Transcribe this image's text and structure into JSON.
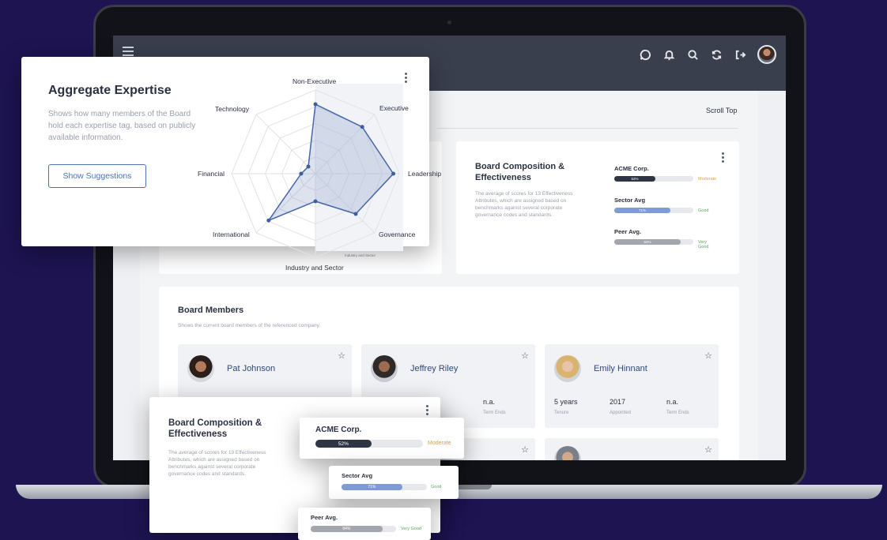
{
  "nav": {
    "icons": [
      "chat-icon",
      "bell-icon",
      "search-icon",
      "refresh-icon",
      "logout-icon"
    ]
  },
  "page": {
    "scroll_top": "Scroll Top"
  },
  "composition": {
    "title": "Board Composition & Effectiveness",
    "title_line1": "Board Composition &",
    "title_line2": "Effectiveness",
    "desc_line1": "The average of scores for 13 Effectiveness",
    "desc_line2": "Attributes, which are assigned based on",
    "desc_line3": "benchmarks against several corporate",
    "desc_line4": "governance codes and standards.",
    "rows": [
      {
        "label": "ACME Corp.",
        "percent": 52,
        "percent_text": "52%",
        "status": "Moderate",
        "status_color": "#d8a43a",
        "bar_color": "#2f3545"
      },
      {
        "label": "Sector Avg",
        "percent": 71,
        "percent_text": "71%",
        "status": "Good",
        "status_color": "#5aa55e",
        "bar_color": "#7e9bd4"
      },
      {
        "label": "Peer Avg.",
        "percent": 84,
        "percent_text": "84%",
        "status": "Very Good",
        "status_color": "#5aa55e",
        "bar_color": "#a3a6ad"
      }
    ]
  },
  "board": {
    "title": "Board Members",
    "desc": "Shows the current board members of the referenced company.",
    "members": [
      {
        "name": "Pat Johnson"
      },
      {
        "name": "Jeffrey Riley",
        "stat2_value": "n.a.",
        "stat2_label": "Term Ends"
      },
      {
        "name": "Emily Hinnant",
        "tenure_value": "5 years",
        "tenure_label": "Tenure",
        "appointed_value": "2017",
        "appointed_label": "Appointed",
        "term_value": "n.a.",
        "term_label": "Term Ends"
      }
    ]
  },
  "aggregate": {
    "title": "Aggregate Expertise",
    "desc": "Shows how many members of the Board hold each expertise tag, based on publicly available information.",
    "button": "Show Suggestions",
    "axes": [
      "Non-Executive",
      "Executive",
      "Leadership",
      "Governance",
      "Industry and Sector",
      "International",
      "Financial",
      "Technology"
    ],
    "values": [
      0.83,
      0.79,
      0.93,
      0.68,
      0.33,
      0.79,
      0.17,
      0.0
    ],
    "small_label": "Industry and Sector"
  }
}
